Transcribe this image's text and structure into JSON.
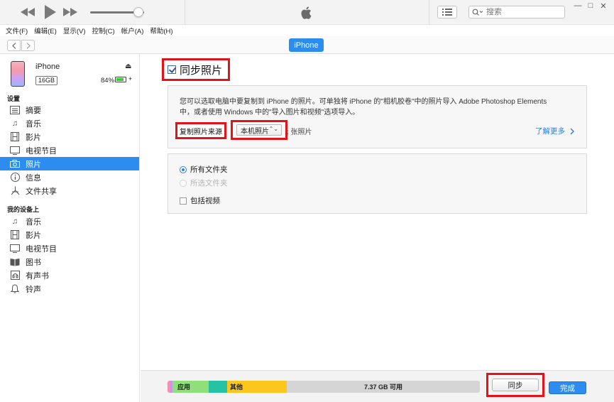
{
  "titlebar": {
    "search_placeholder": "搜索",
    "volume_fraction": 0.9,
    "icons": [
      "rewind-icon",
      "play-icon",
      "fast-forward-icon",
      "apple-logo-icon",
      "list-icon",
      "search-icon"
    ],
    "window_controls": {
      "minimize": "—",
      "maximize": "□",
      "close": "✕"
    }
  },
  "menubar": {
    "items": [
      "文件(F)",
      "编辑(E)",
      "显示(V)",
      "控制(C)",
      "帐户(A)",
      "帮助(H)"
    ]
  },
  "navbar": {
    "device_tab": "iPhone"
  },
  "sidebar": {
    "device": {
      "name": "iPhone",
      "capacity": "16GB",
      "battery": "84%",
      "battery_fraction": 0.84
    },
    "settings_heading": "设置",
    "settings_items": [
      "摘要",
      "音乐",
      "影片",
      "电视节目",
      "照片",
      "信息",
      "文件共享"
    ],
    "active_item": "照片",
    "mydevice_heading": "我的设备上",
    "mydevice_items": [
      "音乐",
      "影片",
      "电视节目",
      "图书",
      "有声书",
      "铃声"
    ]
  },
  "main": {
    "sync_title": "同步照片",
    "sync_checked": true,
    "info_text": "您可以选取电脑中要复制到 iPhone 的照片。可单独将 iPhone 的\"相机胶卷\"中的照片导入 Adobe Photoshop Elements 中，或者使用 Windows 中的\"导入图片和视频\"选项导入。",
    "source_label": "复制照片来源",
    "source_value": "本机照片",
    "photo_count": ": 张照片",
    "learn_more": "了解更多",
    "options": {
      "all_folders": "所有文件夹",
      "selected_folders": "所选文件夹",
      "include_videos": "包括视频"
    }
  },
  "footer": {
    "apps_label": "应用",
    "other_label": "其他",
    "free_label": "7.37 GB 可用",
    "sync_button": "同步",
    "done_button": "完成"
  },
  "colors": {
    "accent": "#2d8cf0",
    "highlight_red": "#e1141c",
    "apps": "#8fe07a",
    "other": "#fbc71c",
    "teal": "#27c1a4"
  }
}
